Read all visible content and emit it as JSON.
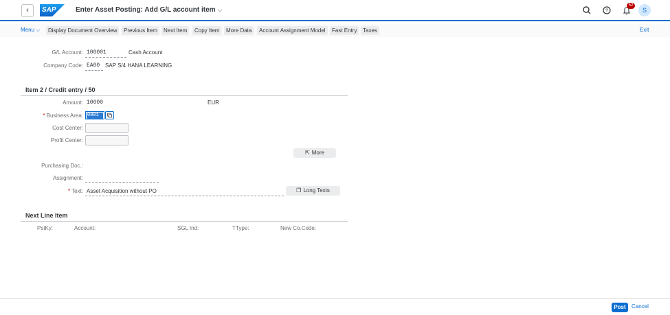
{
  "shell": {
    "back_icon": "‹",
    "logo_text": "SAP",
    "title": "Enter Asset Posting: Add G/L account item",
    "title_chevron": "⌵",
    "notification_count": "52",
    "avatar_initial": "S",
    "brand_color": "#0a6ed1"
  },
  "toolbar": {
    "menu_label": "Menu",
    "buttons": [
      "Display Document Overview",
      "Previous Item",
      "Next Item",
      "Copy Item",
      "More Data",
      "Account Assignment Model",
      "Fast Entry",
      "Taxes"
    ],
    "exit_label": "Exit"
  },
  "header_fields": {
    "gl_account_label": "G/L Account:",
    "gl_account_value": "100001",
    "gl_account_text": "Cash Account",
    "company_code_label": "Company Code:",
    "company_code_value": "EA00",
    "company_code_text": "SAP S/4 HANA LEARNING"
  },
  "item_section": {
    "title": "Item 2 / Credit entry / 50",
    "amount_label": "Amount:",
    "amount_value": "10000",
    "currency": "EUR",
    "business_area_label": "Business Area:",
    "business_area_value": "0001",
    "cost_center_label": "Cost Center:",
    "profit_center_label": "Profit Center:",
    "more_button": "More",
    "purchasing_doc_label": "Purchasing Doc.:",
    "assignment_label": "Assignment:",
    "text_label": "Text:",
    "text_value": "Asset Acquisition without PO",
    "long_texts_button": "Long Texts"
  },
  "next_line": {
    "title": "Next Line Item",
    "columns": [
      "PstKy:",
      "Account:",
      "SGL Ind:",
      "TType:",
      "New Co.Code:"
    ]
  },
  "footer": {
    "post_label": "Post",
    "cancel_label": "Cancel"
  }
}
